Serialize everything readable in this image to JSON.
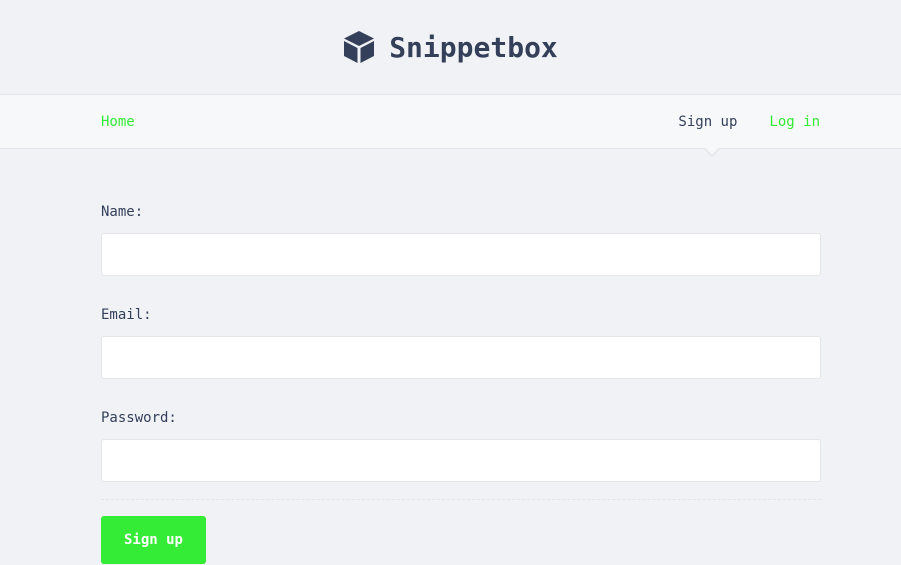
{
  "header": {
    "logo_icon": "cube-icon",
    "title": "Snippetbox"
  },
  "nav": {
    "home_label": "Home",
    "signup_label": "Sign up",
    "login_label": "Log in",
    "active_item": "Sign up"
  },
  "form": {
    "name_label": "Name:",
    "name_value": "",
    "email_label": "Email:",
    "email_value": "",
    "password_label": "Password:",
    "password_value": "",
    "submit_label": "Sign up"
  },
  "colors": {
    "background": "#f1f2f6",
    "navbar_background": "#f7f8fa",
    "text": "#34405a",
    "accent_green": "#34eb35",
    "border": "#e4e5e7"
  }
}
